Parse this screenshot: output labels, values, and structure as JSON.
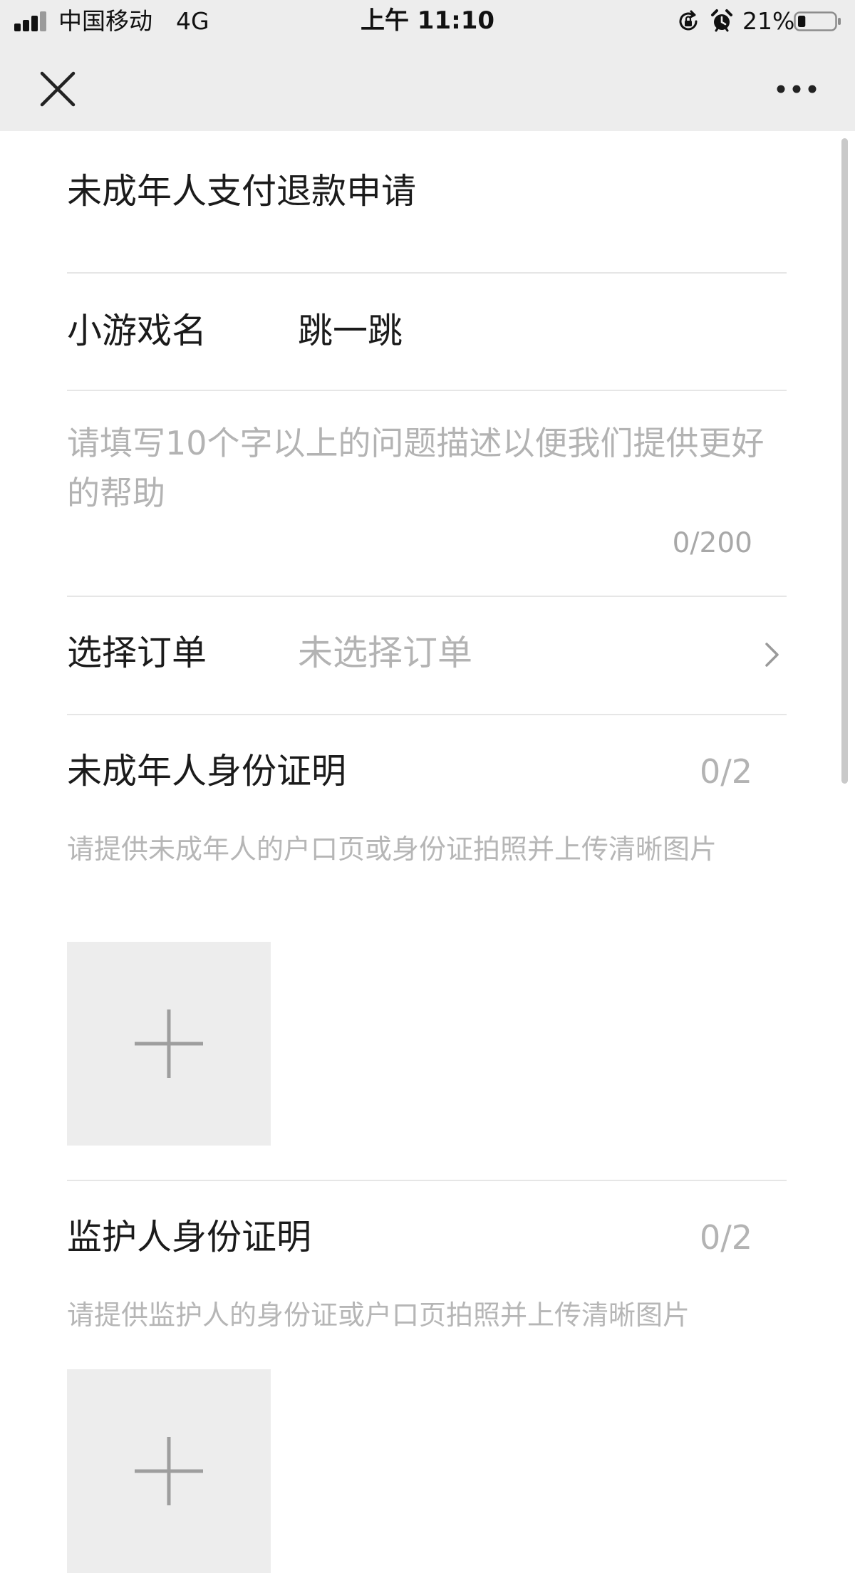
{
  "status_bar": {
    "carrier": "中国移动",
    "network": "4G",
    "time": "上午 11:10",
    "battery_percent": "21%",
    "battery_level": 0.21,
    "icons": [
      "signal-icon",
      "rotation-lock-icon",
      "alarm-icon",
      "battery-icon"
    ]
  },
  "nav_bar": {
    "left_icon": "close-icon",
    "right_icon": "more-icon"
  },
  "form": {
    "title": "未成年人支付退款申请",
    "game": {
      "label": "小游戏名",
      "value": "跳一跳"
    },
    "description": {
      "placeholder": "请填写10个字以上的问题描述以便我们提供更好的帮助",
      "value": "",
      "counter": "0/200"
    },
    "order": {
      "label": "选择订单",
      "value": "未选择订单",
      "icon": "chevron-right-icon"
    },
    "minor_proof": {
      "label": "未成年人身份证明",
      "count": "0/2",
      "hint": "请提供未成年人的户口页或身份证拍照并上传清晰图片",
      "upload_icon": "plus-icon"
    },
    "guardian_proof": {
      "label": "监护人身份证明",
      "count": "0/2",
      "hint": "请提供监护人的身份证或户口页拍照并上传清晰图片",
      "upload_icon": "plus-icon"
    }
  },
  "colors": {
    "header_bg": "#ededed",
    "text": "#1b1b1b",
    "placeholder": "#b3b3b3",
    "divider": "#e6e6e6",
    "upload_tile": "#ededed",
    "plus": "#9e9e9e"
  }
}
